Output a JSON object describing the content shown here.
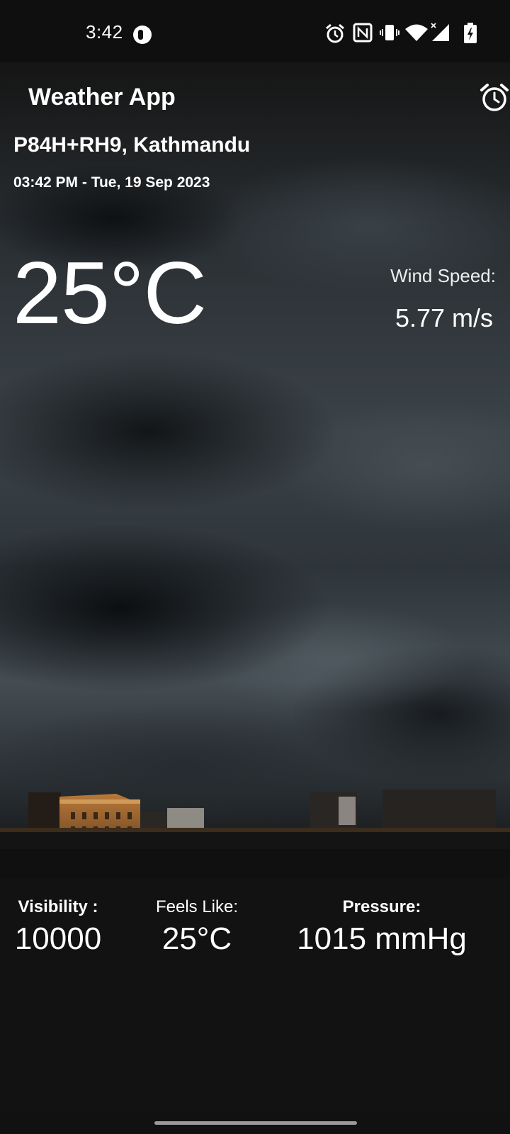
{
  "status_bar": {
    "time": "3:42",
    "icons": [
      "app-notification-icon",
      "alarm-icon",
      "nfc-icon",
      "vibrate-icon",
      "wifi-icon",
      "signal-icon",
      "battery-charging-icon"
    ]
  },
  "header": {
    "title": "Weather App",
    "alarm_icon": "alarm-clock-icon"
  },
  "location": {
    "name": "P84H+RH9, Kathmandu",
    "datetime": "03:42 PM - Tue, 19 Sep 2023"
  },
  "current": {
    "temperature": "25°C",
    "wind_label": "Wind Speed:",
    "wind_value": "5.77 m/s"
  },
  "stats": {
    "visibility_label": "Visibility :",
    "visibility_value": "10000",
    "feels_like_label": "Feels Like:",
    "feels_like_value": "25°C",
    "pressure_label": "Pressure:",
    "pressure_value": "1015 mmHg"
  },
  "colors": {
    "background": "#121212",
    "text": "#ffffff"
  }
}
